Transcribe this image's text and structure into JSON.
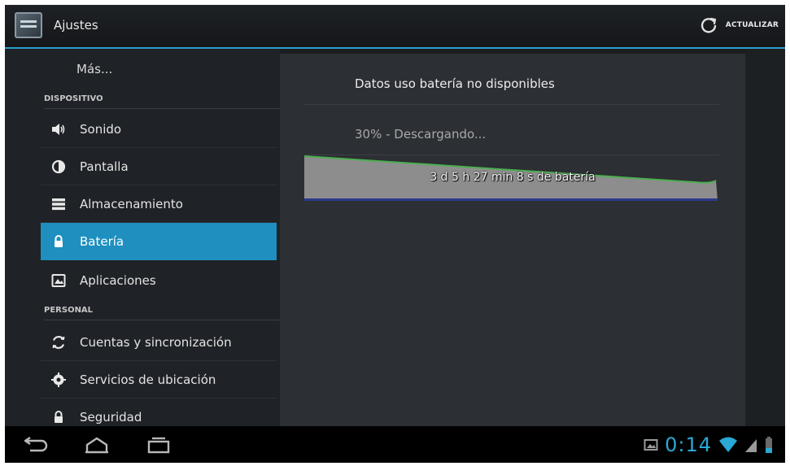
{
  "action_bar": {
    "title": "Ajustes",
    "refresh_label": "ACTUALIZAR"
  },
  "sidebar": {
    "more_label": "Más...",
    "sections": [
      {
        "header": "DISPOSITIVO"
      },
      {
        "header": "PERSONAL"
      }
    ],
    "items": [
      {
        "label": "Sonido",
        "icon": "speaker-icon"
      },
      {
        "label": "Pantalla",
        "icon": "brightness-icon"
      },
      {
        "label": "Almacenamiento",
        "icon": "storage-icon"
      },
      {
        "label": "Batería",
        "icon": "lock-icon",
        "selected": true
      },
      {
        "label": "Aplicaciones",
        "icon": "apps-icon"
      },
      {
        "label": "Cuentas y sincronización",
        "icon": "sync-icon"
      },
      {
        "label": "Servicios de ubicación",
        "icon": "location-icon"
      },
      {
        "label": "Seguridad",
        "icon": "padlock-icon"
      }
    ]
  },
  "battery": {
    "usage_message": "Datos uso batería no disponibles",
    "status": "30% - Descargando...",
    "graph_label": "3 d 5 h 27 min 8 s de batería"
  },
  "status_bar": {
    "clock": "0:14"
  },
  "colors": {
    "accent": "#2a9fc9",
    "selected": "#1e8fbf",
    "graph_line": "#4caf50",
    "graph_fill": "#8d8d8d",
    "graph_base": "#2b3a8c"
  }
}
